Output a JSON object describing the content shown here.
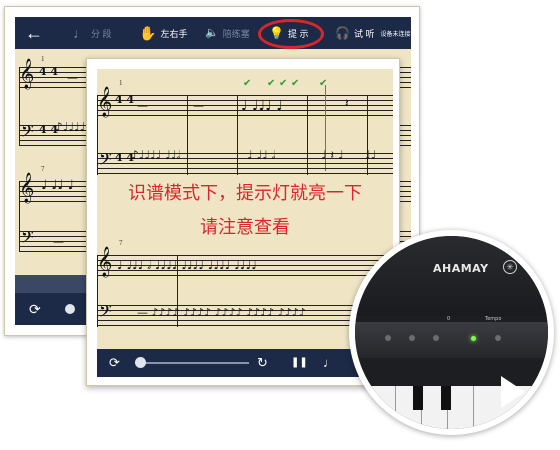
{
  "toolbar": {
    "segment_label": "分 段",
    "hands_label": "左右手",
    "practice_label": "陪练塞",
    "hint_label": "提 示",
    "listen_label": "试 听",
    "device_status": "设备未连接"
  },
  "caption": {
    "line1": "识谱模式下，提示灯就亮一下",
    "line2": "请注意查看"
  },
  "measures": {
    "back_second_row": "7",
    "front_first_row": "1",
    "front_second_row": "7"
  },
  "time_signature": "4 4",
  "device": {
    "brand": "AHAMAY",
    "badge": "✳",
    "tempo_label": "Tempo",
    "zero_label": "0"
  },
  "icons": {
    "back": "←",
    "segment": "♩",
    "hands": "✋",
    "practice": "🔈",
    "hint": "💡",
    "listen": "🎧",
    "loop": "⟳",
    "repeat": "↻",
    "pause": "❚❚",
    "note": "♩"
  },
  "colors": {
    "toolbar": "#1c2a48",
    "paper": "#efe5c5",
    "highlight": "#d8262c",
    "check": "#2e9a38",
    "led": "#7dff4a"
  }
}
